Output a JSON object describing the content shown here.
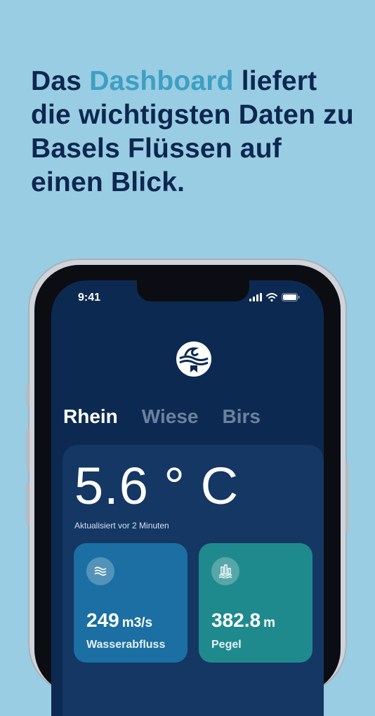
{
  "headline": {
    "part1": "Das ",
    "accent": "Dashboard",
    "part2": " liefert die wichtigsten Daten zu Basels Flüssen auf einen Blick."
  },
  "status_bar": {
    "time": "9:41",
    "icons": [
      "signal-icon",
      "wifi-icon",
      "battery-icon"
    ]
  },
  "app": {
    "logo": "basel-river-logo",
    "tabs": [
      {
        "label": "Rhein",
        "active": true
      },
      {
        "label": "Wiese",
        "active": false
      },
      {
        "label": "Birs",
        "active": false
      }
    ],
    "temperature": "5.6 ° C",
    "updated": "Aktualisiert vor 2 Minuten",
    "tiles": [
      {
        "value": "249",
        "unit": "m3/s",
        "label": "Wasserabfluss",
        "icon": "waves-icon"
      },
      {
        "value": "382.8",
        "unit": "m",
        "label": "Pegel",
        "icon": "water-level-icon"
      }
    ]
  },
  "colors": {
    "background": "#99cde3",
    "headline": "#0d2750",
    "accent": "#3d9fc4",
    "screen": "#0c2a51",
    "card": "#143764",
    "tile_flow": "#1b6fa2",
    "tile_level": "#1f8a8d"
  }
}
